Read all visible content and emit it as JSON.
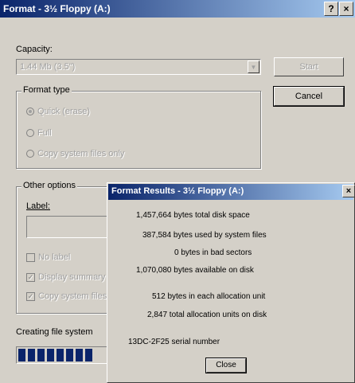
{
  "window": {
    "title": "Format - 3½ Floppy (A:)",
    "help_glyph": "?",
    "close_glyph": "×"
  },
  "capacity": {
    "label": "Capacity:",
    "value": "1.44 Mb (3.5\")",
    "arrow": "▼"
  },
  "buttons": {
    "start": "Start",
    "cancel": "Cancel"
  },
  "format_type": {
    "title": "Format type",
    "options": [
      {
        "label": "Quick (erase)",
        "selected": true
      },
      {
        "label": "Full",
        "selected": false
      },
      {
        "label": "Copy system files only",
        "selected": false
      }
    ]
  },
  "other_options": {
    "title": "Other options",
    "label_caption": "Label:",
    "label_value": "",
    "checks": [
      {
        "label": "No label",
        "checked": false
      },
      {
        "label": "Display summary",
        "checked": true
      },
      {
        "label": "Copy system files",
        "checked": true
      }
    ]
  },
  "status": {
    "text": "Creating file system",
    "progress_blocks": 8
  },
  "results": {
    "title": "Format Results - 3½ Floppy (A:)",
    "close_glyph": "×",
    "lines": [
      "1,457,664 bytes total disk space",
      "387,584 bytes used by system files",
      "0 bytes in bad sectors",
      "1,070,080 bytes available on disk",
      "512 bytes in each allocation unit",
      "2,847 total allocation units on disk",
      "13DC-2F25 serial number"
    ],
    "close_button": "Close"
  }
}
